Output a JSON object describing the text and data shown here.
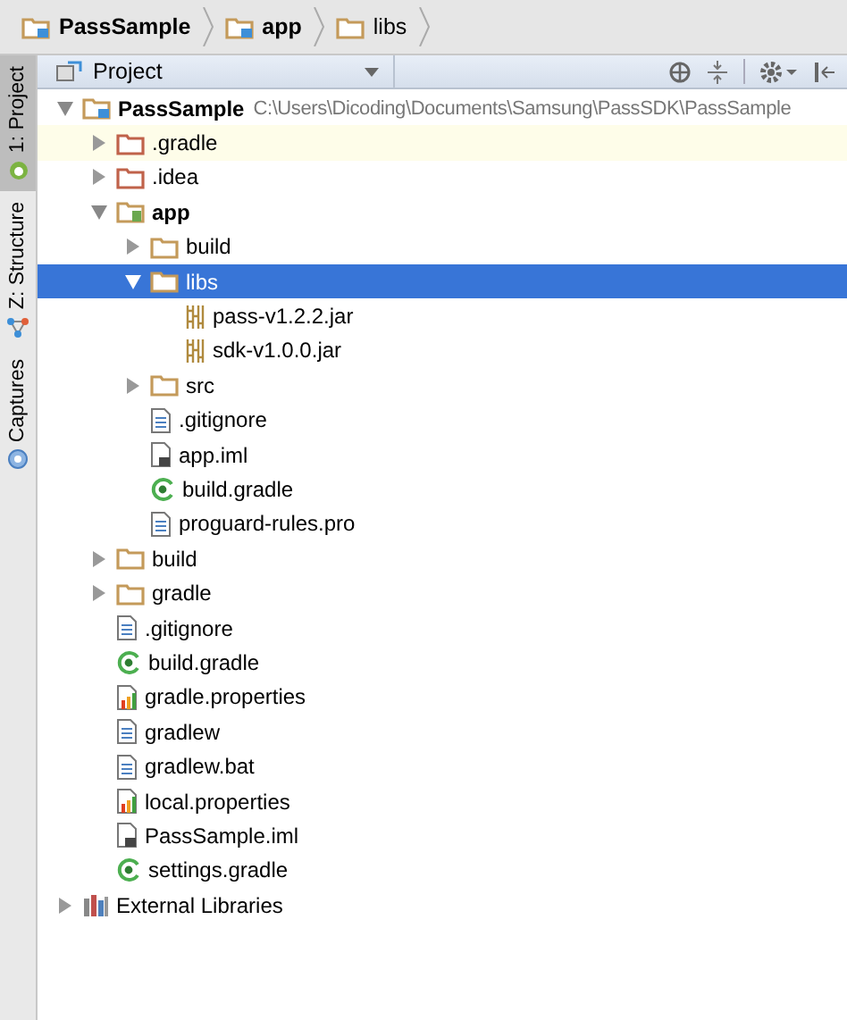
{
  "breadcrumbs": [
    {
      "label": "PassSample",
      "kind": "module"
    },
    {
      "label": "app",
      "kind": "module"
    },
    {
      "label": "libs",
      "kind": "folder"
    }
  ],
  "side_tabs": [
    {
      "label": "1: Project",
      "kind": "android",
      "selected": true
    },
    {
      "label": "Z: Structure",
      "kind": "structure",
      "selected": false
    },
    {
      "label": "Captures",
      "kind": "captures",
      "selected": false
    }
  ],
  "panel": {
    "view": "Project"
  },
  "tree": [
    {
      "label": "PassSample",
      "path": "C:\\Users\\Dicoding\\Documents\\Samsung\\PassSDK\\PassSample",
      "kind": "module",
      "expanded": true,
      "selected": false,
      "hovered": false,
      "children": [
        {
          "label": ".gradle",
          "kind": "excluded",
          "expanded": false,
          "selected": false,
          "hovered": true
        },
        {
          "label": ".idea",
          "kind": "excluded",
          "expanded": false,
          "selected": false,
          "hovered": false
        },
        {
          "label": "app",
          "kind": "android",
          "expanded": true,
          "selected": false,
          "hovered": false,
          "children": [
            {
              "label": "build",
              "kind": "folder",
              "expanded": false,
              "selected": false,
              "hovered": false
            },
            {
              "label": "libs",
              "kind": "folder",
              "expanded": true,
              "selected": true,
              "hovered": false,
              "children": [
                {
                  "label": "pass-v1.2.2.jar",
                  "kind": "jar",
                  "selected": false,
                  "hovered": false
                },
                {
                  "label": "sdk-v1.0.0.jar",
                  "kind": "jar",
                  "selected": false,
                  "hovered": false
                }
              ]
            },
            {
              "label": "src",
              "kind": "folder",
              "expanded": false,
              "selected": false,
              "hovered": false
            },
            {
              "label": ".gitignore",
              "kind": "text",
              "selected": false,
              "hovered": false
            },
            {
              "label": "app.iml",
              "kind": "iml",
              "selected": false,
              "hovered": false
            },
            {
              "label": "build.gradle",
              "kind": "gradle",
              "selected": false,
              "hovered": false
            },
            {
              "label": "proguard-rules.pro",
              "kind": "text",
              "selected": false,
              "hovered": false
            }
          ]
        },
        {
          "label": "build",
          "kind": "folder",
          "expanded": false,
          "selected": false,
          "hovered": false
        },
        {
          "label": "gradle",
          "kind": "folder",
          "expanded": false,
          "selected": false,
          "hovered": false
        },
        {
          "label": ".gitignore",
          "kind": "text",
          "selected": false,
          "hovered": false
        },
        {
          "label": "build.gradle",
          "kind": "gradle",
          "selected": false,
          "hovered": false
        },
        {
          "label": "gradle.properties",
          "kind": "properties",
          "selected": false,
          "hovered": false
        },
        {
          "label": "gradlew",
          "kind": "text",
          "selected": false,
          "hovered": false
        },
        {
          "label": "gradlew.bat",
          "kind": "text",
          "selected": false,
          "hovered": false
        },
        {
          "label": "local.properties",
          "kind": "properties",
          "selected": false,
          "hovered": false
        },
        {
          "label": "PassSample.iml",
          "kind": "iml",
          "selected": false,
          "hovered": false
        },
        {
          "label": "settings.gradle",
          "kind": "gradle",
          "selected": false,
          "hovered": false
        }
      ]
    },
    {
      "label": "External Libraries",
      "kind": "library",
      "expanded": false,
      "selected": false,
      "hovered": false
    }
  ]
}
